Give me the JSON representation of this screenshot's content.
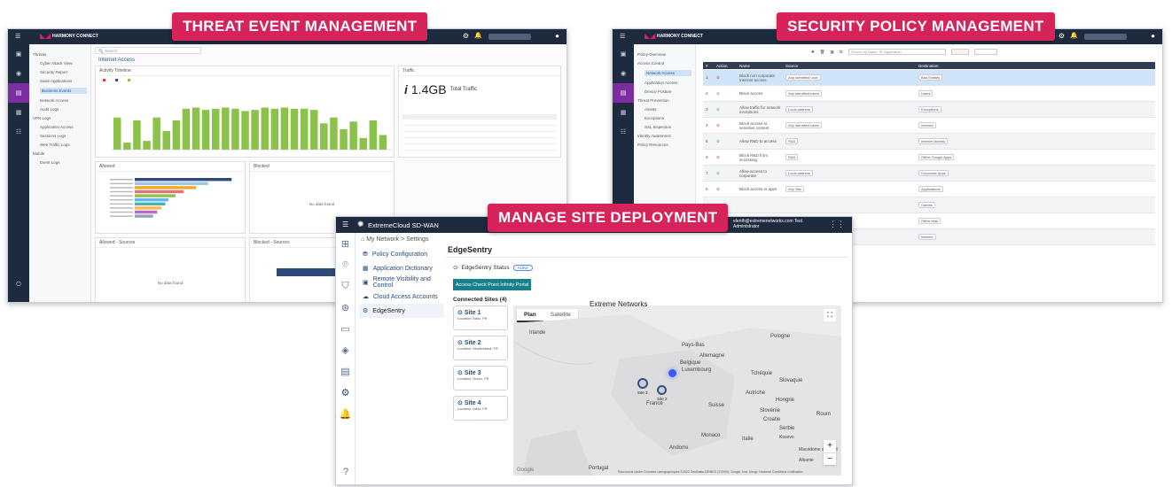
{
  "banners": {
    "left": "THREAT EVENT MANAGEMENT",
    "right": "SECURITY POLICY MANAGEMENT",
    "center": "MANAGE SITE DEPLOYMENT"
  },
  "colors": {
    "banner": "#d6235a",
    "nav_dark": "#1e2a3e",
    "bar_green": "#8bc34a",
    "accent_teal": "#17808a",
    "link_blue": "#1f4f88"
  },
  "tep": {
    "brand": "HARMONY CONNECT",
    "search_placeholder": "Search",
    "section": "Internet Access",
    "activity": "Activity Timeline",
    "traffic_title": "Traffic",
    "traffic_value": "1.4GB",
    "traffic_label": "Total Traffic",
    "allowed": "Allowed",
    "blocked": "Blocked",
    "allowed_sources": "Allowed - Sources",
    "blocked_sources": "Blocked - Sources",
    "no_data": "No data found",
    "nav": [
      "Threats",
      "Cyber Attack View",
      "Security Report",
      "SaaS Applications",
      "Business Events",
      "Network Access",
      "Audit Logs",
      "VPN Logs",
      "Application Access",
      "Sessions Logs",
      "Web Traffic Logs",
      "Mobile",
      "Event Logs"
    ],
    "bars": [
      0.55,
      0.12,
      0.5,
      0.15,
      0.55,
      0.32,
      0.5,
      0.7,
      0.72,
      0.68,
      0.7,
      0.72,
      0.7,
      0.66,
      0.68,
      0.72,
      0.7,
      0.72,
      0.7,
      0.7,
      0.68,
      0.45,
      0.55,
      0.35,
      0.48,
      0.2,
      0.5,
      0.25
    ],
    "hbars": [
      0.95,
      0.72,
      0.6,
      0.48,
      0.4,
      0.33,
      0.3,
      0.26,
      0.22,
      0.18
    ]
  },
  "spm": {
    "brand": "HARMONY CONNECT",
    "search_placeholder": "Search by Name, IP, Application",
    "nav": [
      "Policy Overview",
      "Access Control",
      "Network Access",
      "Application Access",
      "Device Posture",
      "Threat Prevention",
      "Assets",
      "Exceptions",
      "SSL Inspection",
      "Identity Awareness",
      "Policy Resources"
    ],
    "columns": [
      "#",
      "Action",
      "Name",
      "Source",
      "Destination"
    ],
    "rows": [
      {
        "num": "1",
        "name": "Block non corporate Internet access",
        "source": "Any Identified User",
        "dest": "Bad Entities"
      },
      {
        "num": "2",
        "name": "Block access",
        "source": "Any identified users",
        "dest": "Users"
      },
      {
        "num": "3",
        "name": "Allow traffic for network exceptions",
        "source": "Local address",
        "dest": "Exceptions"
      },
      {
        "num": "4",
        "name": "Block access to sensitive content",
        "source": "Any identified users",
        "dest": "Internet"
      },
      {
        "num": "5",
        "name": "Allow R&D to access",
        "source": "R&D",
        "dest": "Internet Access"
      },
      {
        "num": "6",
        "name": "Block R&D from accessing",
        "source": "R&D",
        "dest": "Office Google Apps"
      },
      {
        "num": "7",
        "name": "Allow access to corporate",
        "source": "Local address",
        "dest": "Corporate Apps"
      },
      {
        "num": "8",
        "name": "Block access to apps",
        "source": "Any Site",
        "dest": "Applications"
      },
      {
        "num": "9",
        "name": "",
        "source": "",
        "dest": "Games"
      },
      {
        "num": "10",
        "name": "",
        "source": "",
        "dest": "Office Mail"
      },
      {
        "num": "11",
        "name": "",
        "source": "",
        "dest": "Internet"
      }
    ]
  },
  "sdwan": {
    "app": "ExtremeCloud SD-WAN",
    "breadcrumb": "My Network > Settings",
    "user": "elenth@extremenetworks.com Test Administrator",
    "menu": [
      "Policy Configuration",
      "Application Dictionary",
      "Remote Visibility and Control",
      "Cloud Access Accounts",
      "EdgeSentry"
    ],
    "page_title": "EdgeSentry",
    "status_label": "EdgeSentry Status",
    "status_value": "Active",
    "portal_button": "Access Check Point Infinity Portal",
    "connected_sites": "Connected Sites (4)",
    "sites": [
      {
        "name": "Site 1",
        "loc": "Location: Metz, FR"
      },
      {
        "name": "Site 2",
        "loc": "Location: Montbéliard, FR"
      },
      {
        "name": "Site 3",
        "loc": "Location: Dreux, FR"
      },
      {
        "name": "Site 4",
        "loc": "Location: Metz, FR"
      }
    ],
    "map_tabs": [
      "Plan",
      "Satellite"
    ],
    "map_title": "Extreme Networks",
    "map_labels": [
      "Irlande",
      "Pays-Bas",
      "Pologne",
      "Belgique",
      "Luxembourg",
      "Allemagne",
      "Tchéquie",
      "Slovaquie",
      "Autriche",
      "Hongrie",
      "Suisse",
      "Slovénie",
      "Croatie",
      "Serbie",
      "Roum",
      "France",
      "Monaco",
      "Italie",
      "Andorre",
      "Portugal",
      "Kosovo",
      "Macédoine du Nord",
      "Albanie"
    ],
    "cluster_labels": [
      "Site 3",
      "Site 2"
    ],
    "google": "Google",
    "attribution": "Raccourcis clavier   Données cartographiques ©2022 GeoBasis-DE/BKG (©2009), Google, Inst. Geogr. Nacional   Conditions d'utilisation",
    "zoom_in": "+",
    "zoom_out": "−"
  }
}
